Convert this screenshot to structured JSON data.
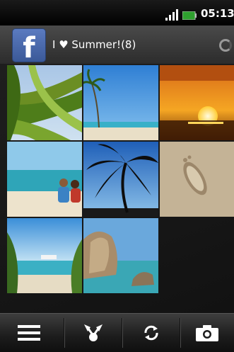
{
  "status_bar": {
    "time": "05:13",
    "icons": [
      "signal-icon",
      "battery-icon"
    ]
  },
  "header": {
    "logo_letter": "f",
    "album_title": "I ♥ Summer!(8)",
    "loading_indicator": "spinner-icon"
  },
  "photos": [
    {
      "name": "palm-leaf-photo"
    },
    {
      "name": "beach-palm-photo"
    },
    {
      "name": "sunset-photo"
    },
    {
      "name": "couple-on-beach-photo"
    },
    {
      "name": "palm-silhouette-photo"
    },
    {
      "name": "footprint-in-sand-photo"
    },
    {
      "name": "cruise-ship-beach-photo"
    },
    {
      "name": "rocky-shore-photo"
    }
  ],
  "toolbar": {
    "buttons": [
      "menu-icon",
      "share-icon",
      "refresh-icon",
      "camera-icon"
    ]
  }
}
